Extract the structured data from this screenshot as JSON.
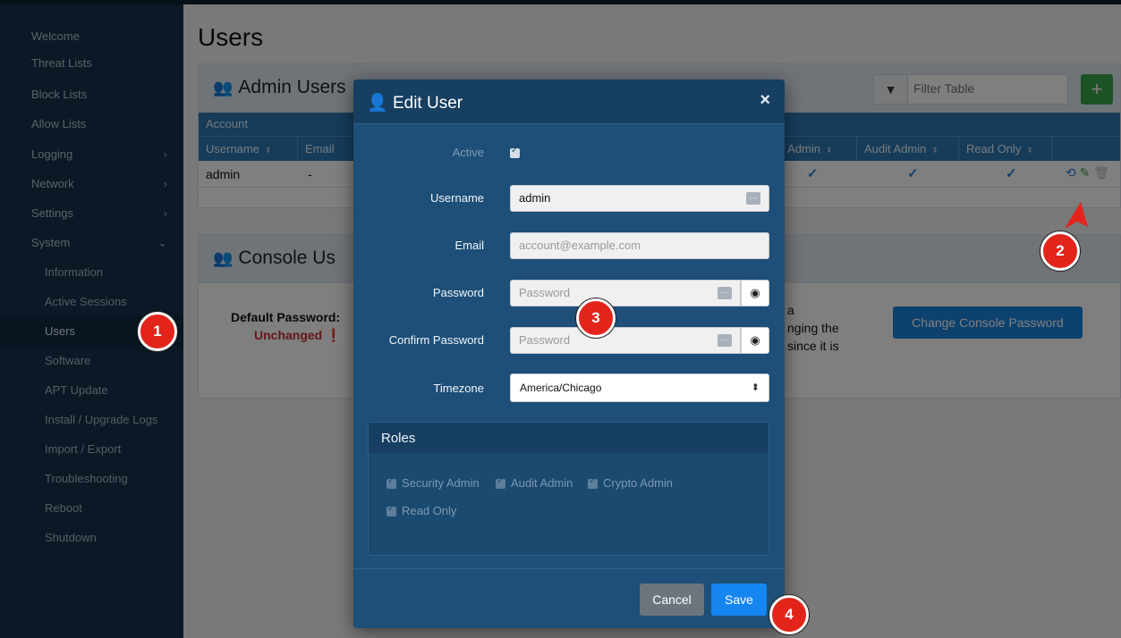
{
  "sidebar": {
    "items": [
      {
        "label": "Welcome"
      },
      {
        "label": "Threat Lists"
      },
      {
        "label": "Block Lists"
      },
      {
        "label": "Allow Lists"
      },
      {
        "label": "Logging",
        "chevron": ">"
      },
      {
        "label": "Network",
        "chevron": ">"
      },
      {
        "label": "Settings",
        "chevron": ">"
      },
      {
        "label": "System",
        "chevron": "v"
      }
    ],
    "subitems": [
      {
        "label": "Information"
      },
      {
        "label": "Active Sessions"
      },
      {
        "label": "Users",
        "active": true
      },
      {
        "label": "Software"
      },
      {
        "label": "APT Update"
      },
      {
        "label": "Install / Upgrade Logs"
      },
      {
        "label": "Import / Export"
      },
      {
        "label": "Troubleshooting"
      },
      {
        "label": "Reboot"
      },
      {
        "label": "Shutdown"
      }
    ]
  },
  "page": {
    "title": "Users"
  },
  "admin_panel": {
    "title": "Admin Users",
    "filter_placeholder": "Filter Table",
    "add_label": "+",
    "group_header": "Account",
    "columns": [
      "Username",
      "Email",
      "Crypto Admin",
      "Audit Admin",
      "Read Only"
    ],
    "columns_visible": [
      "Username",
      "Email",
      "o Admin",
      "Audit Admin",
      "Read Only"
    ],
    "row": {
      "username": "admin",
      "email": "-"
    }
  },
  "console_panel": {
    "title": "Console Users",
    "title_visible": "Console Us",
    "default_password_label": "Default Password:",
    "status": "Unchanged",
    "text_fragments": [
      "a",
      "nging the",
      "since it is"
    ],
    "change_button": "Change Console Password"
  },
  "modal": {
    "title": "Edit User",
    "close": "×",
    "active_label": "Active",
    "username_label": "Username",
    "username_value": "admin",
    "email_label": "Email",
    "email_placeholder": "account@example.com",
    "password_label": "Password",
    "password_placeholder": "Password",
    "confirm_label": "Confirm Password",
    "confirm_placeholder": "Password",
    "timezone_label": "Timezone",
    "timezone_value": "America/Chicago",
    "roles_title": "Roles",
    "roles": [
      "Security Admin",
      "Audit Admin",
      "Crypto Admin",
      "Read Only"
    ],
    "cancel": "Cancel",
    "save": "Save"
  },
  "markers": [
    "1",
    "2",
    "3",
    "4"
  ],
  "colors": {
    "sidebar_bg": "#15324a",
    "modal_bg": "#1d4f78",
    "table_header": "#2d79b5",
    "primary": "#1585f0",
    "success": "#3aa54a",
    "danger": "#c9302c",
    "marker": "#e3241b"
  }
}
